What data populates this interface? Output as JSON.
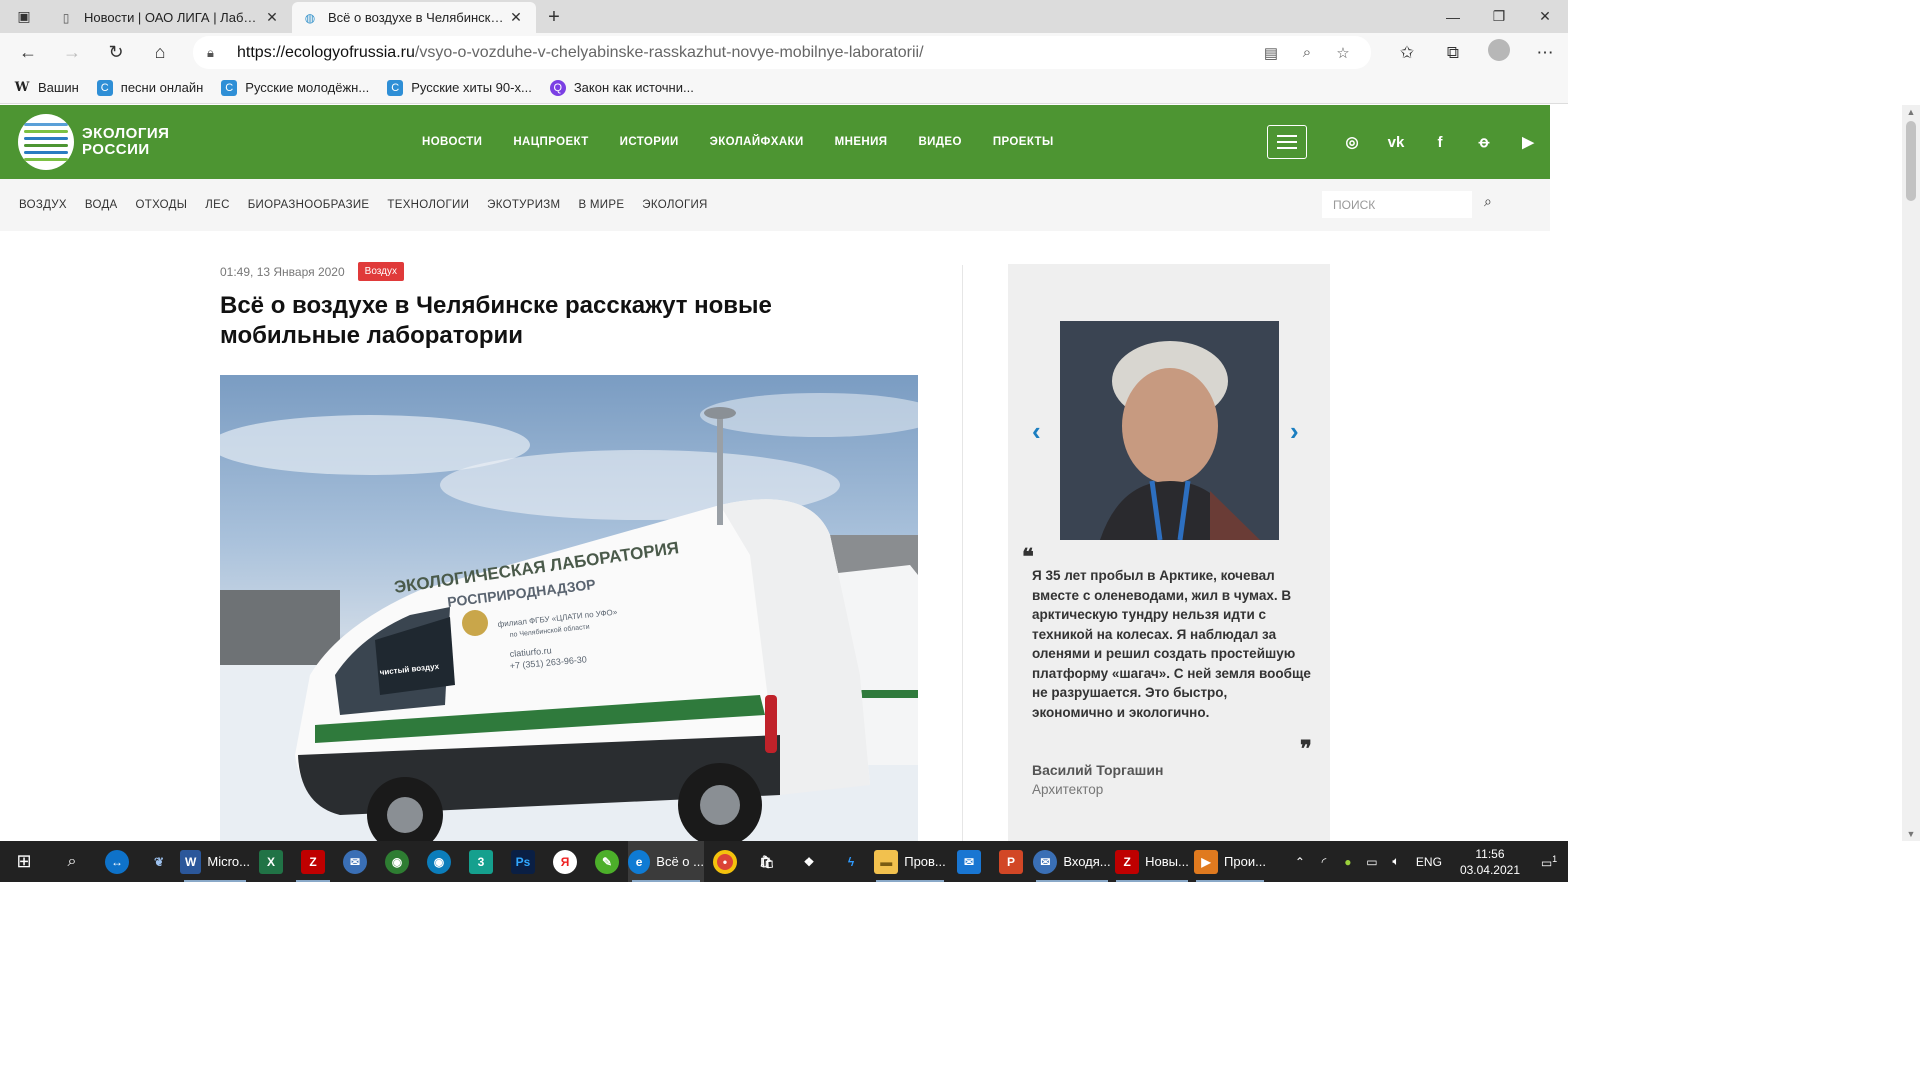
{
  "browser": {
    "tabs": [
      {
        "title": "Новости | ОАО ЛИГА | Лаборат...",
        "active": false
      },
      {
        "title": "Всё о воздухе в Челябинске ра...",
        "active": true
      }
    ],
    "url_host": "https://ecologyofrussia.ru",
    "url_path": "/vsyo-o-vozduhe-v-chelyabinske-rasskazhut-novye-mobilnye-laboratorii/",
    "favorites": [
      "Вашин",
      "песни онлайн",
      "Русские молодёжн...",
      "Русские хиты 90-х...",
      "Закон как источни..."
    ]
  },
  "site": {
    "logo_line1": "ЭКОЛОГИЯ",
    "logo_line2": "РОССИИ",
    "main_nav": [
      "НОВОСТИ",
      "НАЦПРОЕКТ",
      "ИСТОРИИ",
      "ЭКОЛАЙФХАКИ",
      "МНЕНИЯ",
      "ВИДЕО",
      "ПРОЕКТЫ"
    ],
    "sub_nav": [
      "ВОЗДУХ",
      "ВОДА",
      "ОТХОДЫ",
      "ЛЕС",
      "БИОРАЗНООБРАЗИЕ",
      "ТЕХНОЛОГИИ",
      "ЭКОТУРИЗМ",
      "В МИРЕ",
      "ЭКОЛОГИЯ"
    ],
    "search_placeholder": "ПОИСК"
  },
  "article": {
    "date": "01:49, 13 Января 2020",
    "category": "Воздух",
    "title": "Всё о воздухе в Челябинске расскажут новые мобильные лаборатории",
    "photo_lettering": [
      "ЭКОЛОГИЧЕСКАЯ ЛАБОРАТОРИЯ",
      "РОСПРИРОДНАДЗОР",
      "филиал ФГБУ «ЦЛАТИ по УФО»",
      "по Челябинской области",
      "clatiurfo.ru",
      "+7 (351) 263-96-30",
      "чистый воздух"
    ]
  },
  "sidebar": {
    "quote": "Я 35 лет пробыл в Арктике, кочевал вместе с оленеводами, жил в чумах. В арктическую тундру нельзя идти с техникой на колесах. Я наблюдал за оленями и решил создать простейшую платформу «шагач». С ней земля вообще не разрушается. Это быстро, экономично и экологично.",
    "author": "Василий Торгашин",
    "role": "Архитектор"
  },
  "taskbar": {
    "items": [
      {
        "label": "Micro...",
        "icon": "word-icon",
        "color": "#2b579a",
        "glyph": "W"
      },
      {
        "label": "",
        "icon": "excel-icon",
        "color": "#217346",
        "glyph": "X"
      },
      {
        "label": "",
        "icon": "filezilla-icon",
        "color": "#bf0000",
        "glyph": "Z"
      },
      {
        "label": "Всё о ...",
        "icon": "edge-icon",
        "color": "#0f7bd4",
        "glyph": "e"
      },
      {
        "label": "Пров...",
        "icon": "explorer-icon",
        "color": "#f2c14e",
        "glyph": "▬"
      },
      {
        "label": "Входя...",
        "icon": "thunderbird-icon",
        "color": "#3a6fb5",
        "glyph": "✉"
      },
      {
        "label": "Новы...",
        "icon": "filezilla2-icon",
        "color": "#bf0000",
        "glyph": "Z"
      },
      {
        "label": "Прои...",
        "icon": "media-icon",
        "color": "#e07a1f",
        "glyph": "▶"
      }
    ],
    "lang": "ENG",
    "time": "11:56",
    "date": "03.04.2021",
    "notifications": "1"
  },
  "colors": {
    "brand_green": "#4d9532",
    "badge_red": "#e03a3a",
    "accent_blue": "#1b7ec0"
  }
}
